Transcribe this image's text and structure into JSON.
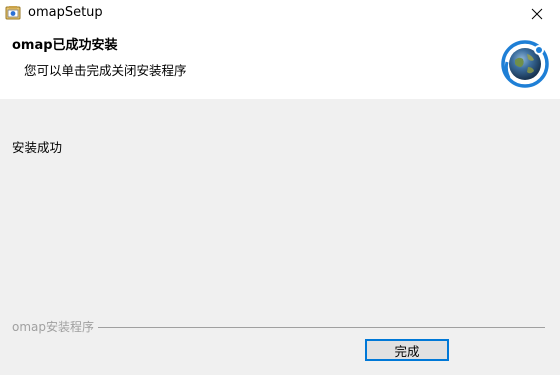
{
  "window": {
    "title": "omapSetup",
    "app_icon": "installer-icon",
    "close_icon": "close-icon"
  },
  "header": {
    "title": "omap已成功安装",
    "subtitle": "您可以单击完成关闭安装程序",
    "logo_icon": "globe-logo-icon"
  },
  "main": {
    "status_text": "安装成功"
  },
  "footer": {
    "branding": "omap安装程序",
    "finish_label": "完成"
  },
  "colors": {
    "header_bg": "#ffffff",
    "content_bg": "#f0f0f0",
    "focus_border": "#0078d7",
    "branding_text": "#a0a0a0"
  }
}
